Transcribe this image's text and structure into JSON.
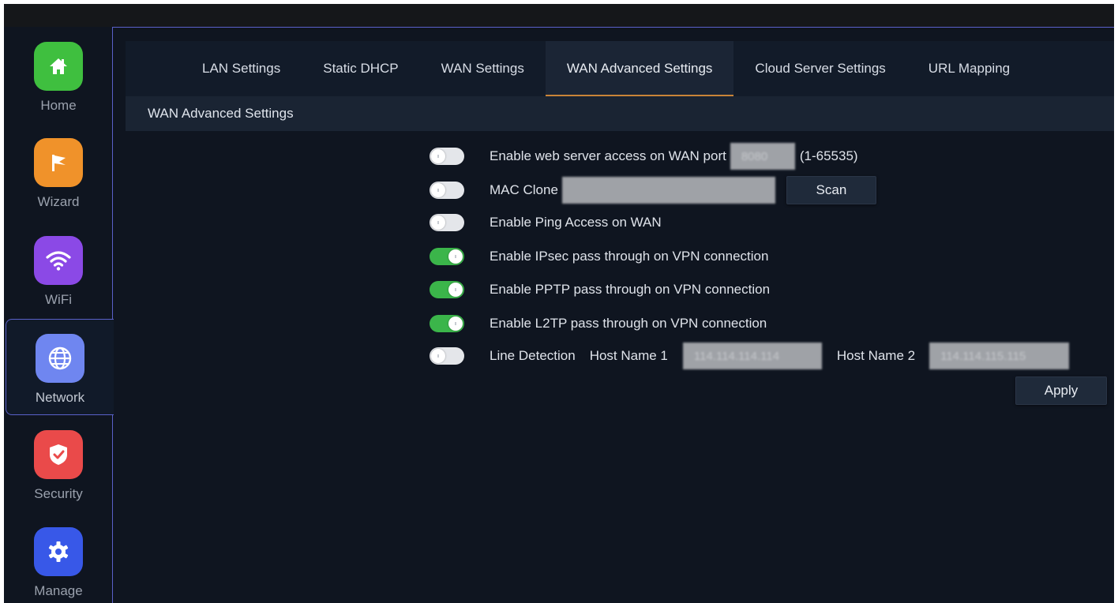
{
  "sidebar": {
    "items": [
      {
        "label": "Home",
        "icon": "home-icon",
        "color": "#3fbf3f"
      },
      {
        "label": "Wizard",
        "icon": "flag-icon",
        "color": "#f0922a"
      },
      {
        "label": "WiFi",
        "icon": "wifi-icon",
        "color": "#8b49e6"
      },
      {
        "label": "Network",
        "icon": "globe-icon",
        "color": "#6f86f0"
      },
      {
        "label": "Security",
        "icon": "shield-icon",
        "color": "#ea4a4a"
      },
      {
        "label": "Manage",
        "icon": "gear-icon",
        "color": "#3858e8"
      }
    ],
    "active": "Network"
  },
  "tabs": [
    {
      "label": "LAN Settings"
    },
    {
      "label": "Static DHCP"
    },
    {
      "label": "WAN Settings"
    },
    {
      "label": "WAN Advanced Settings"
    },
    {
      "label": "Cloud Server Settings"
    },
    {
      "label": "URL Mapping"
    }
  ],
  "active_tab": "WAN Advanced Settings",
  "section_title": "WAN Advanced Settings",
  "settings": {
    "web_server": {
      "label": "Enable web server access on WAN port",
      "enabled": false,
      "port_value": "8080",
      "range_hint": "(1-65535)"
    },
    "mac_clone": {
      "label": "MAC Clone",
      "enabled": false,
      "value": "",
      "scan_label": "Scan"
    },
    "ping": {
      "label": "Enable Ping Access on WAN",
      "enabled": false
    },
    "ipsec": {
      "label": "Enable IPsec pass through on VPN connection",
      "enabled": true
    },
    "pptp": {
      "label": "Enable PPTP pass through on VPN connection",
      "enabled": true
    },
    "l2tp": {
      "label": "Enable L2TP pass through on VPN connection",
      "enabled": true
    },
    "line_detection": {
      "label": "Line Detection",
      "enabled": false,
      "host1_label": "Host Name 1",
      "host1_value": "114.114.114.114",
      "host2_label": "Host Name 2",
      "host2_value": "114.114.115.115"
    }
  },
  "apply_label": "Apply",
  "colors": {
    "accent": "#c98438",
    "toggle_on": "#3bb54a",
    "sidebar_border": "#5a61c9"
  }
}
